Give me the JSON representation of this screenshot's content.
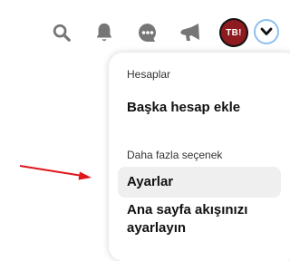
{
  "header": {
    "icons": [
      "search-icon",
      "bell-icon",
      "chat-icon",
      "megaphone-icon",
      "chevron-down-icon"
    ],
    "avatar_initials": "TB!",
    "avatar_color": "#8e1b1f",
    "focus_ring_color": "#8fbff0"
  },
  "menu": {
    "accounts_label": "Hesaplar",
    "add_account": "Başka hesap ekle",
    "more_options_label": "Daha fazla seçenek",
    "settings": "Ayarlar",
    "tune_home_feed": "Ana sayfa akışınızı ayarlayın"
  },
  "annotation": {
    "arrow_color": "#e0161b"
  }
}
